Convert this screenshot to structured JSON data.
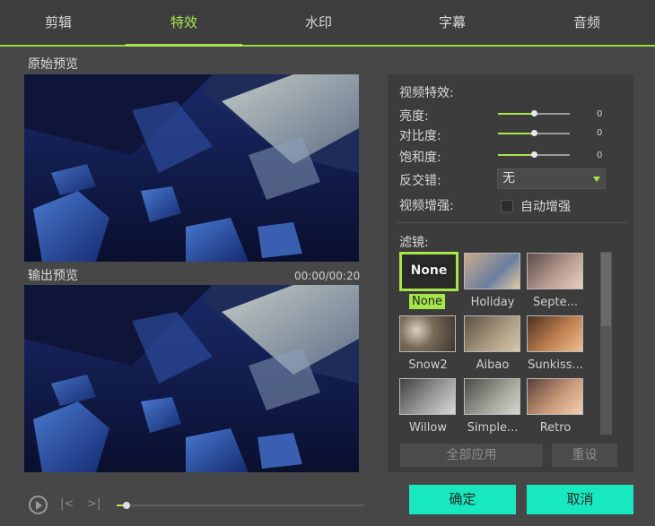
{
  "tabs": [
    {
      "label": "剪辑"
    },
    {
      "label": "特效"
    },
    {
      "label": "水印"
    },
    {
      "label": "字幕"
    },
    {
      "label": "音频"
    }
  ],
  "active_tab": 1,
  "preview": {
    "original_label": "原始预览",
    "output_label": "输出预览",
    "time": "00:00/00:20"
  },
  "playback": {
    "progress": 0.04
  },
  "effects": {
    "section_label": "视频特效:",
    "brightness": {
      "label": "亮度:",
      "value": "0",
      "level": 0.5
    },
    "contrast": {
      "label": "对比度:",
      "value": "0",
      "level": 0.5
    },
    "saturation": {
      "label": "饱和度:",
      "value": "0",
      "level": 0.5
    },
    "deinterlace": {
      "label": "反交错:",
      "selected": "无"
    },
    "enhance": {
      "label": "视频增强:",
      "checkbox_label": "自动增强",
      "checked": false
    }
  },
  "filters": {
    "label": "滤镜:",
    "items": [
      {
        "name": "None",
        "thumb_text": "None",
        "selected": true
      },
      {
        "name": "Holiday"
      },
      {
        "name": "Septe..."
      },
      {
        "name": "Snow2"
      },
      {
        "name": "Aibao"
      },
      {
        "name": "Sunkiss..."
      },
      {
        "name": "Willow"
      },
      {
        "name": "Simple..."
      },
      {
        "name": "Retro"
      }
    ]
  },
  "panel_buttons": {
    "apply_all": "全部应用",
    "reset": "重设"
  },
  "footer": {
    "ok": "确定",
    "cancel": "取消"
  },
  "colors": {
    "accent": "#a6e64a",
    "confirm": "#18e8c0"
  }
}
